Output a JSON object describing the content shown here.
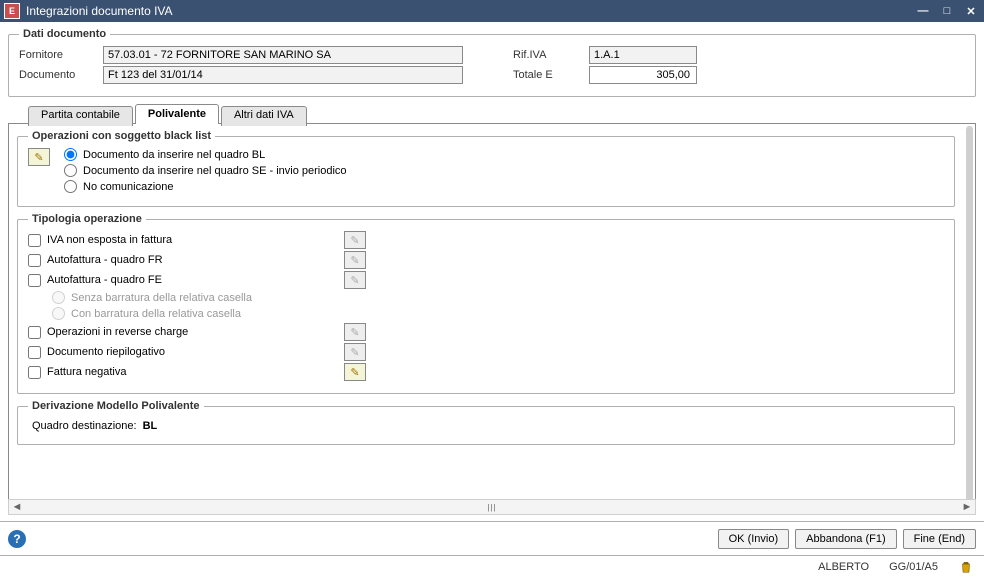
{
  "window": {
    "title": "Integrazioni documento IVA",
    "app_icon_letter": "E"
  },
  "dati_documento": {
    "legend": "Dati documento",
    "fornitore_label": "Fornitore",
    "fornitore_value": "57.03.01 - 72 FORNITORE SAN MARINO SA",
    "documento_label": "Documento",
    "documento_value": "Ft 123 del 31/01/14",
    "rif_iva_label": "Rif.IVA",
    "rif_iva_value": "1.A.1",
    "totale_label": "Totale  E",
    "totale_value": "305,00"
  },
  "tabs": {
    "partita": "Partita contabile",
    "polivalente": "Polivalente",
    "altri": "Altri dati IVA"
  },
  "blacklist": {
    "legend": "Operazioni con soggetto black list",
    "opt_bl": "Documento da inserire nel quadro BL",
    "opt_se": "Documento da inserire nel quadro SE - invio periodico",
    "opt_no": "No comunicazione"
  },
  "tipologia": {
    "legend": "Tipologia operazione",
    "iva_non_esposta": "IVA non esposta in fattura",
    "autofattura_fr": "Autofattura - quadro FR",
    "autofattura_fe": "Autofattura - quadro FE",
    "senza_barratura": "Senza barratura della relativa casella",
    "con_barratura": "Con barratura della relativa casella",
    "reverse_charge": "Operazioni in reverse charge",
    "riepilogativo": "Documento riepilogativo",
    "negativa": "Fattura negativa"
  },
  "derivazione": {
    "legend": "Derivazione Modello Polivalente",
    "dest_label": "Quadro destinazione:",
    "dest_value": "BL"
  },
  "footer": {
    "ok": "OK (Invio)",
    "abbandona": "Abbandona (F1)",
    "fine": "Fine (End)"
  },
  "statusbar": {
    "user": "ALBERTO",
    "session": "GG/01/A5"
  },
  "icons": {
    "pencil": "✎"
  }
}
